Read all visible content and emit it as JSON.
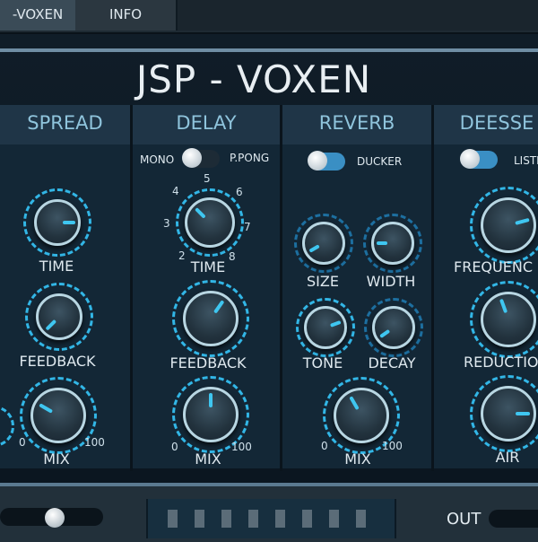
{
  "tabs": {
    "active": "-VOXEN",
    "info": "INFO"
  },
  "title": "JSP - VOXEN",
  "sections": {
    "spread": {
      "header": "SPREAD",
      "time": "TIME",
      "feedback": "FEEDBACK",
      "mix": "MIX",
      "mix_min": "0",
      "mix_max": "100"
    },
    "delay": {
      "header": "DELAY",
      "mode_left": "MONO",
      "mode_right": "P.PONG",
      "time_ticks": [
        "2",
        "3",
        "4",
        "5",
        "6",
        "7",
        "8"
      ],
      "time": "TIME",
      "feedback": "FEEDBACK",
      "mix": "MIX",
      "mix_min": "0",
      "mix_max": "100"
    },
    "reverb": {
      "header": "REVERB",
      "ducker": "DUCKER",
      "size": "SIZE",
      "width": "WIDTH",
      "tone": "TONE",
      "decay": "DECAY",
      "mix": "MIX",
      "mix_min": "0",
      "mix_max": "100"
    },
    "deesser": {
      "header": "DEESSE",
      "listen": "LISTE",
      "frequency": "FREQUENC",
      "reduction": "REDUCTIO",
      "air": "AIR"
    }
  },
  "output": {
    "label": "OUT"
  },
  "colors": {
    "accent": "#3fc6f0",
    "header_text": "#8fc4dc",
    "panel": "#132736"
  }
}
